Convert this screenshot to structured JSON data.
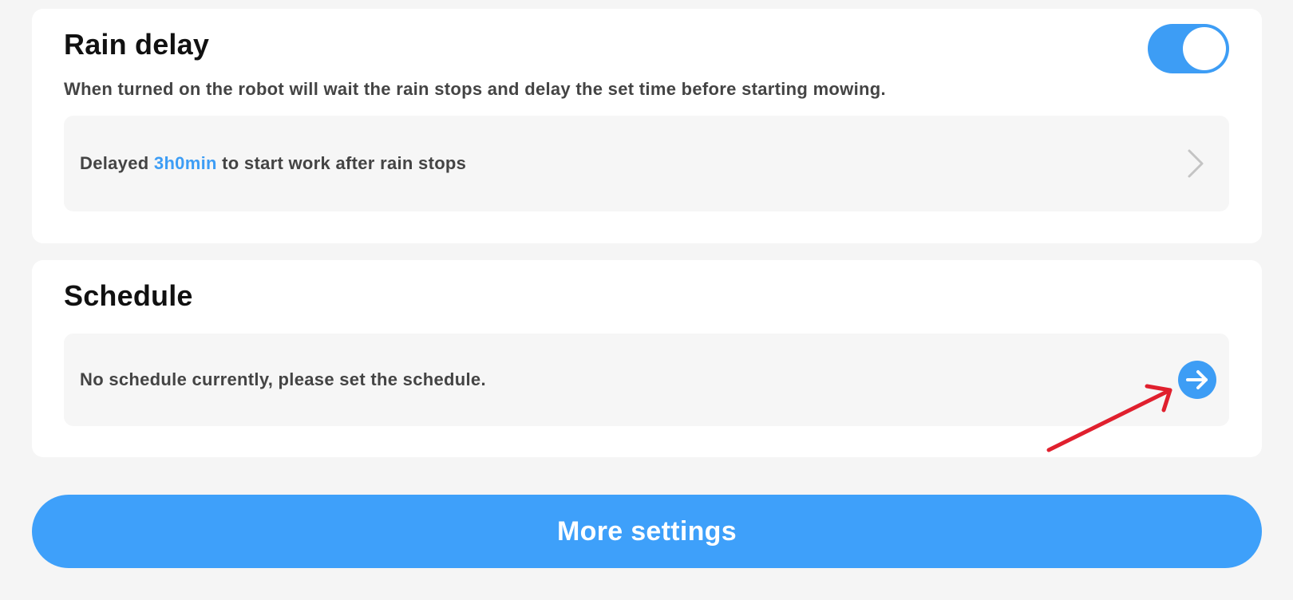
{
  "rain_delay": {
    "title": "Rain delay",
    "description": "When turned on the robot will wait the rain stops and delay the set time before starting mowing.",
    "toggle_on": true,
    "delay_prefix": "Delayed ",
    "delay_value": "3h0min",
    "delay_suffix": " to start work after rain stops",
    "chevron_icon": "chevron-right-icon"
  },
  "schedule": {
    "title": "Schedule",
    "empty_text": "No schedule currently, please set the schedule.",
    "action_icon": "arrow-right-circle-icon"
  },
  "annotation": {
    "icon": "red-arrow-annotation",
    "color": "#e0202e"
  },
  "footer": {
    "more_settings_label": "More settings"
  },
  "colors": {
    "accent": "#3d9df5",
    "background": "#f5f5f5",
    "card": "#ffffff",
    "row": "#f6f6f6"
  }
}
